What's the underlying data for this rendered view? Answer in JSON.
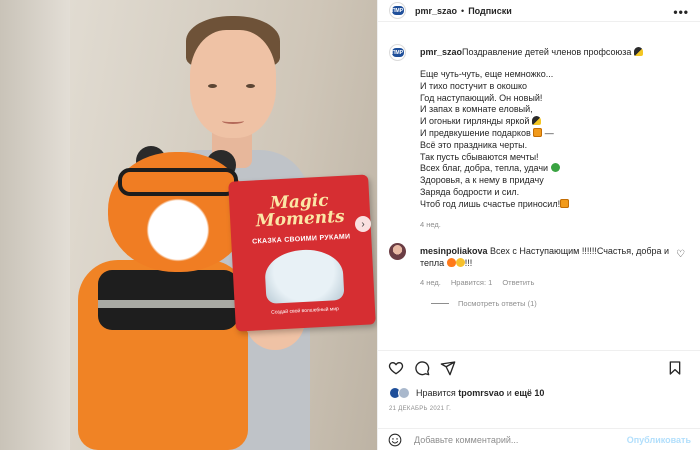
{
  "post": {
    "username": "pmr_szao",
    "follow_label": "Подписки",
    "dot": "•",
    "more_label": "•••",
    "avatar_logo_text": "ПМР",
    "caption_title": "Поздравление детей членов профсоюза",
    "poem_lines": [
      "Еще чуть-чуть, еще немножко...",
      "И тихо постучит в окошко",
      "Год наступающий. Он новый!",
      "И запах в комнате еловый,",
      "И огоньки гирлянды яркой",
      "И предвкушение подарков",
      "Всё это праздника черты.",
      "Так пусть сбываются мечты!",
      "Всех благ, добра, тепла, удачи",
      "Здоровья, а к нему в придачу",
      "Заряда бодрости и сил.",
      "Чтоб год лишь счастье приносил!"
    ],
    "line_suffix_5": " —",
    "caption_time": "4 нед."
  },
  "photo": {
    "box_title": "Magic Moments",
    "box_subtitle": "СКАЗКА СВОИМИ РУКАМИ",
    "box_footer": "Создай свой волшебный мир",
    "next_icon": "›"
  },
  "comment": {
    "username": "mesinpoliakova",
    "text": "Всех с Наступающим !!!!!!Счастья, добра и тепла",
    "text_tail": "!!!",
    "time": "4 нед.",
    "likes": "Нравится: 1",
    "reply_label": "Ответить",
    "view_replies": "Посмотреть ответы (1)"
  },
  "likes": {
    "prefix": "Нравится",
    "user": "tpomrsvao",
    "middle": "и",
    "others": "ещё 10"
  },
  "date": "21 ДЕКАБРЬ 2021 Г.",
  "add_comment": {
    "placeholder": "Добавьте комментарий...",
    "publish_label": "Опубликовать"
  },
  "colors": {
    "accent_blue": "#b2dffc",
    "meta_gray": "#8e8e8e",
    "brand_blue": "#1f4f9a"
  },
  "icons": [
    "heart-icon",
    "comment-icon",
    "share-icon",
    "save-icon",
    "emoji-icon",
    "more-icon"
  ]
}
